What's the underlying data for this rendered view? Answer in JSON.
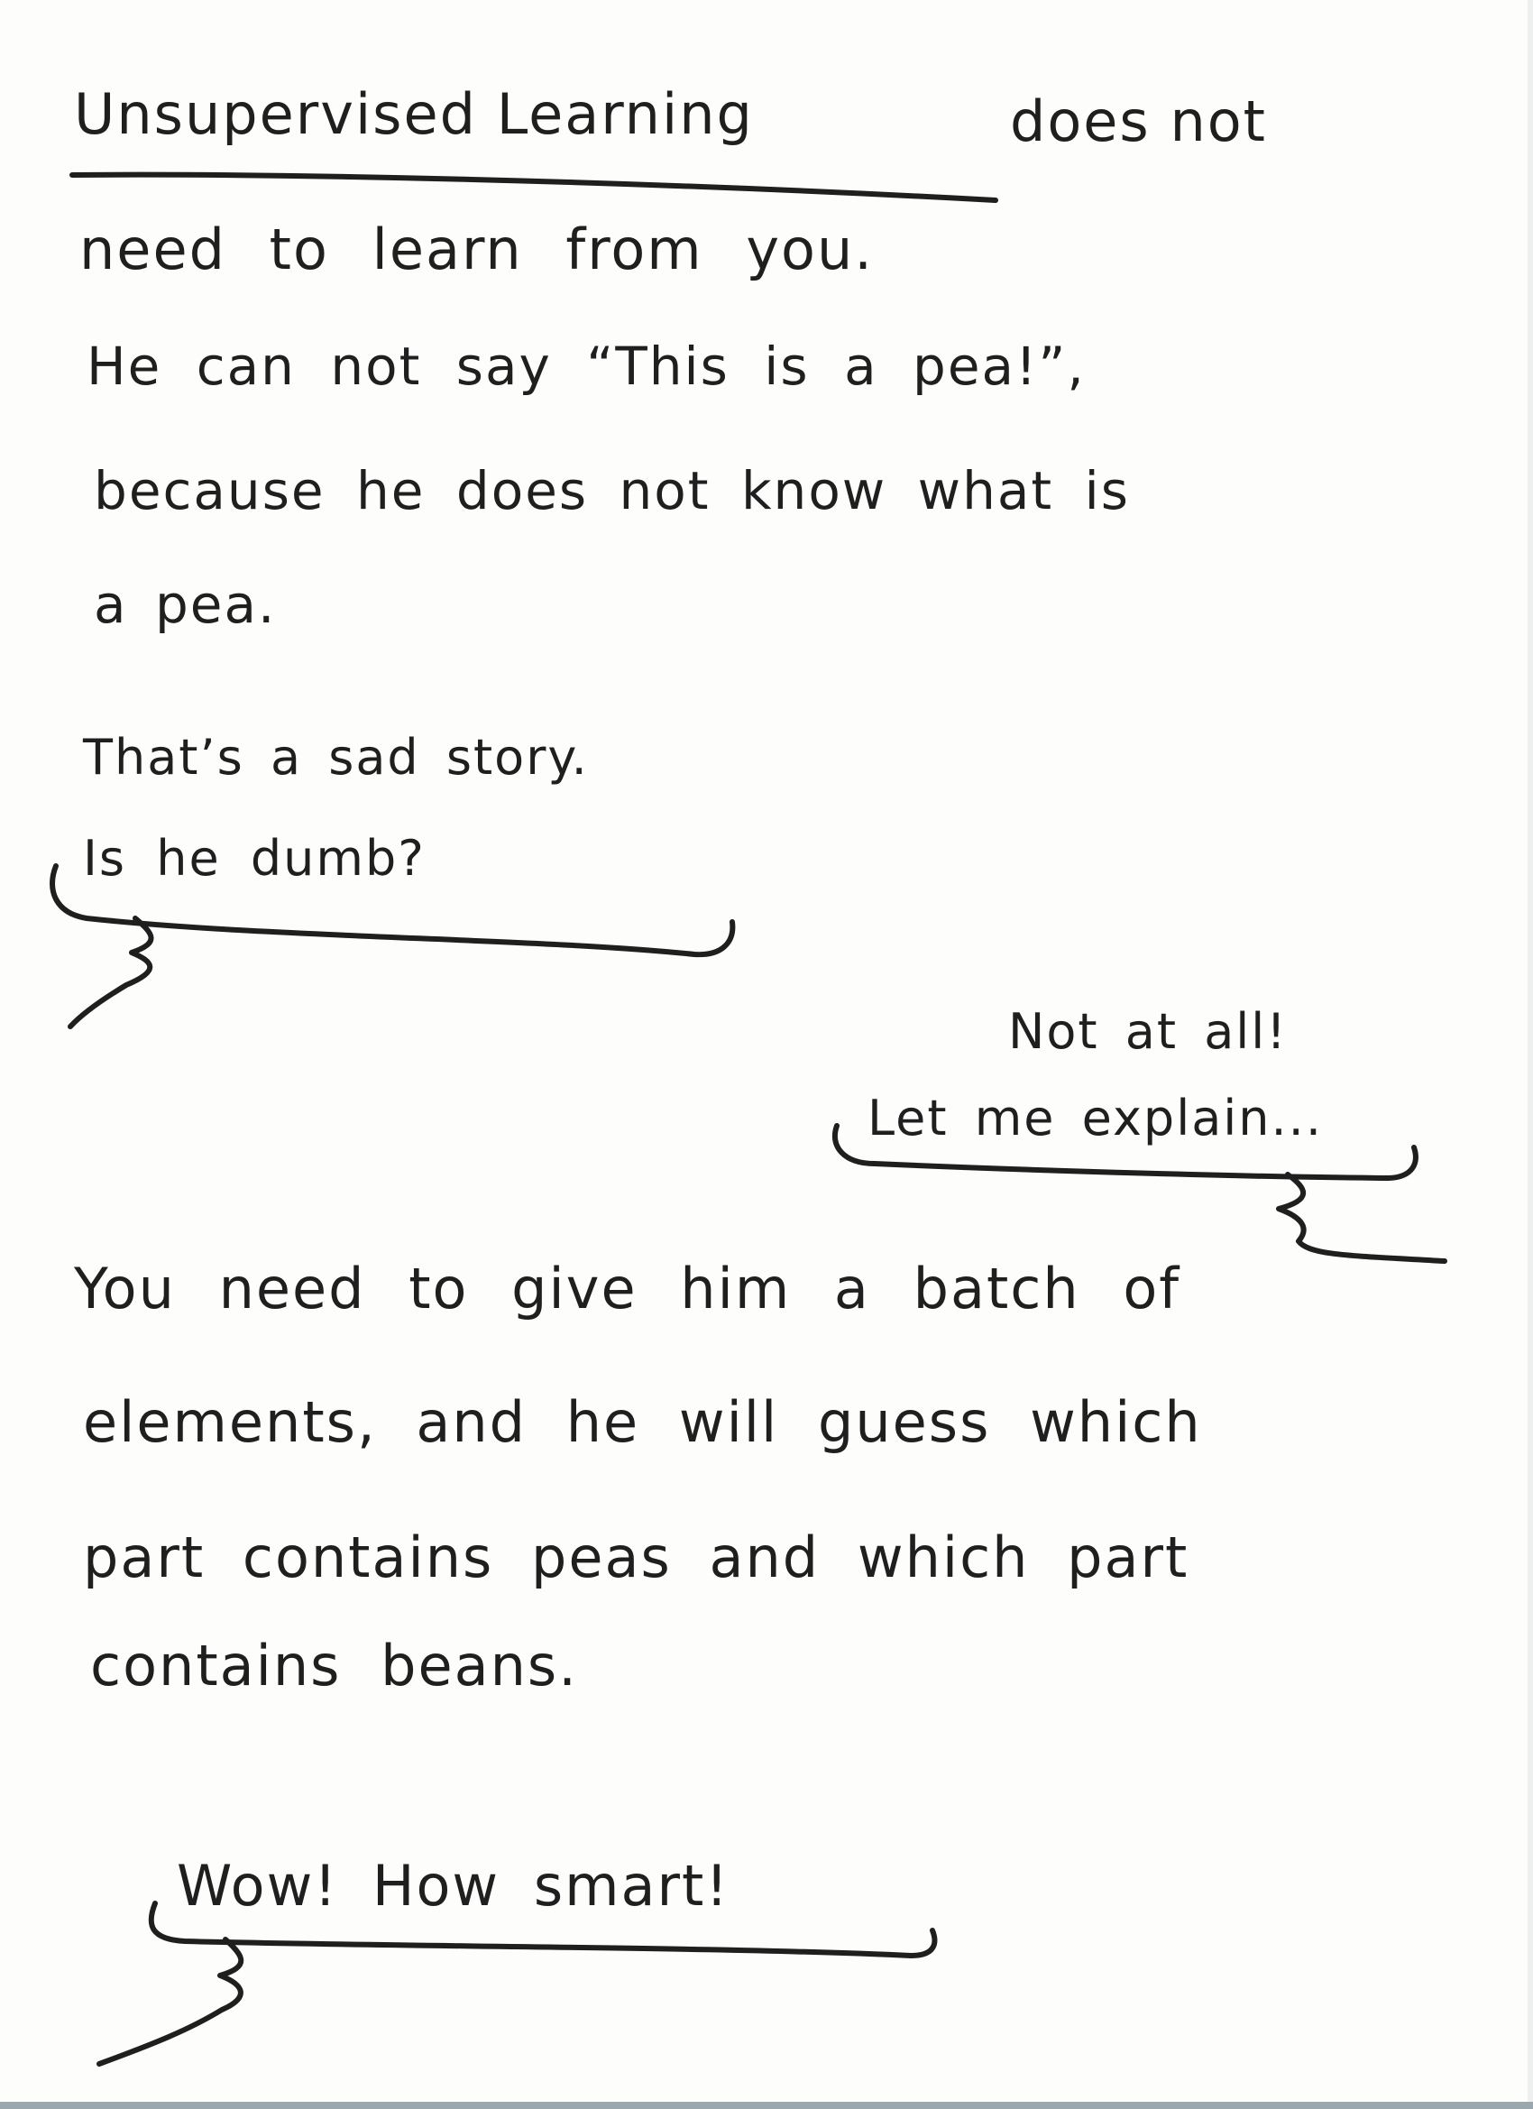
{
  "intro": {
    "line1_title": "Unsupervised Learning",
    "line1_rest": "does not",
    "line2": "need to learn from you.",
    "line3": "He can not say “This is a pea!”,",
    "line4": "because he does not know what is",
    "line5": "a pea."
  },
  "bubble1": {
    "line1": "That’s a sad story.",
    "line2": "Is he dumb?"
  },
  "bubble2": {
    "line1": "Not at all!",
    "line2": "Let me explain..."
  },
  "explanation": {
    "line1": "You need to give him a batch of",
    "line2": "elements, and he will guess which",
    "line3": "part contains peas and which part",
    "line4": "contains beans."
  },
  "bubble3": {
    "line1": "Wow! How smart!"
  },
  "colors": {
    "ink": "#1f1f1f",
    "paper": "#fdfdfc"
  }
}
